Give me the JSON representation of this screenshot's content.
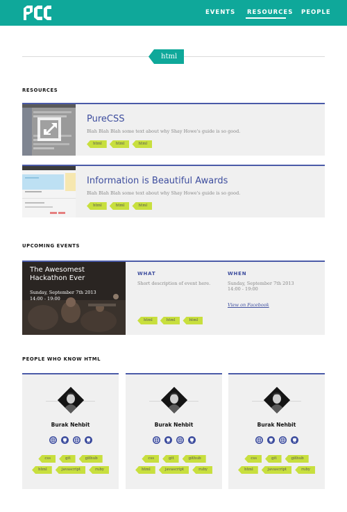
{
  "colors": {
    "brand": "#0fa89a",
    "accent": "#3d4d9e",
    "tag": "#c8df3e",
    "card": "#f0f0f0"
  },
  "header": {
    "logo_icon": "pcc-logo",
    "nav": [
      {
        "label": "EVENTS",
        "active": false
      },
      {
        "label": "RESOURCES",
        "active": true
      },
      {
        "label": "PEOPLE",
        "active": false
      }
    ]
  },
  "topic": {
    "label": "html"
  },
  "resources": {
    "heading": "RESOURCES",
    "items": [
      {
        "title": "PureCSS",
        "description": "Blah Blah Blah some text about why Shay Howe's guide is so good.",
        "tags": [
          "html",
          "html",
          "html"
        ]
      },
      {
        "title": "Information is Beautiful Awards",
        "description": "Blah Blah Blah some text about why Shay Howe's guide is so good.",
        "tags": [
          "html",
          "html",
          "html"
        ]
      }
    ]
  },
  "events": {
    "heading": "UPCOMING EVENTS",
    "items": [
      {
        "image_title": "The Awesomest Hackathon Ever",
        "image_date": "Sunday, September 7th 2013",
        "image_time": "14:00 - 19:00",
        "what_label": "WHAT",
        "what_text": "Short description of event here.",
        "when_label": "WHEN",
        "when_date": "Sunday, September 7th 2013",
        "when_time": "14:00 - 19:00",
        "link": "View on Facebook",
        "tags": [
          "html",
          "html",
          "html"
        ]
      }
    ]
  },
  "people": {
    "heading": "PEOPLE WHO KNOW HTML",
    "items": [
      {
        "name": "Burak Nehbit",
        "socials": [
          "globe-icon",
          "github-icon",
          "globe-icon",
          "github-icon"
        ],
        "tags_row1": [
          "css",
          "git",
          "github"
        ],
        "tags_row2": [
          "html",
          "javascript",
          "ruby"
        ]
      },
      {
        "name": "Burak Nehbit",
        "socials": [
          "globe-icon",
          "github-icon",
          "globe-icon",
          "github-icon"
        ],
        "tags_row1": [
          "css",
          "git",
          "github"
        ],
        "tags_row2": [
          "html",
          "javascript",
          "ruby"
        ]
      },
      {
        "name": "Burak Nehbit",
        "socials": [
          "globe-icon",
          "github-icon",
          "globe-icon",
          "github-icon"
        ],
        "tags_row1": [
          "css",
          "git",
          "github"
        ],
        "tags_row2": [
          "html",
          "javascript",
          "ruby"
        ]
      }
    ]
  }
}
